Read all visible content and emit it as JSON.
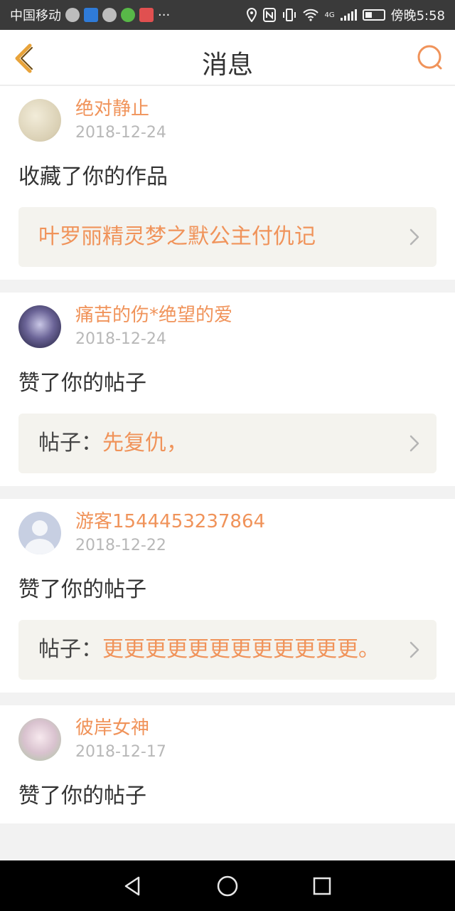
{
  "status_bar": {
    "carrier": "中国移动",
    "more": "···",
    "network": "4G",
    "time": "傍晚5:58"
  },
  "nav": {
    "title": "消息"
  },
  "messages": [
    {
      "name": "绝对静止",
      "date": "2018-12-24",
      "action": "收藏了你的作品",
      "ref_prefix": "",
      "ref_title": "叶罗丽精灵梦之默公主付仇记"
    },
    {
      "name": "痛苦的伤*绝望的爱",
      "date": "2018-12-24",
      "action": "赞了你的帖子",
      "ref_prefix": "帖子：",
      "ref_title": "先复仇，"
    },
    {
      "name": "游客1544453237864",
      "date": "2018-12-22",
      "action": "赞了你的帖子",
      "ref_prefix": "帖子：",
      "ref_title": "更更更更更更更更更更更更。"
    },
    {
      "name": "彼岸女神",
      "date": "2018-12-17",
      "action": "赞了你的帖子"
    }
  ],
  "colors": {
    "accent": "#f0935a",
    "status_bar": "#3a3a3a",
    "nav_icon": "#f0935a"
  },
  "icons": {
    "back": "chevron-left-icon",
    "search": "search-icon",
    "ref_arrow": "chevron-right-icon",
    "nav_back": "triangle-back-icon",
    "nav_home": "circle-home-icon",
    "nav_recent": "square-recent-icon"
  }
}
